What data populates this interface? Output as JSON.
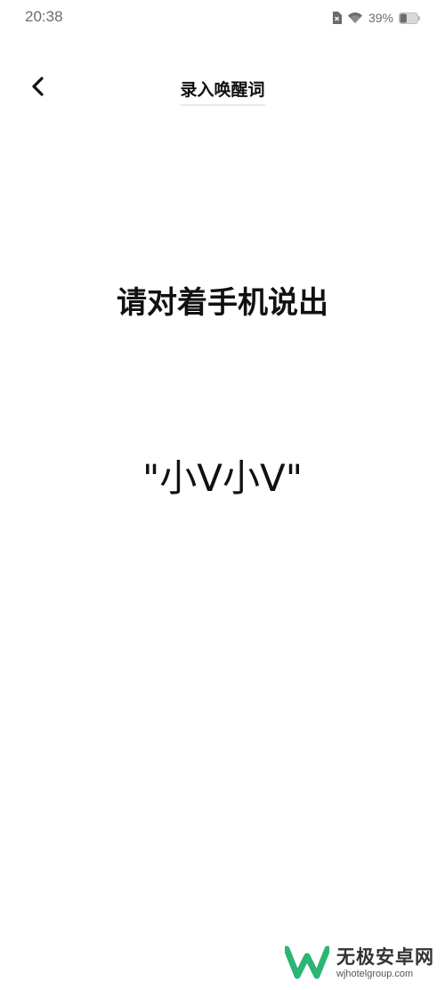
{
  "status_bar": {
    "time": "20:38",
    "battery_percent": "39%",
    "battery_level": 0.39,
    "icons": [
      "sim-off-icon",
      "wifi-icon",
      "battery-icon"
    ]
  },
  "header": {
    "title": "录入唤醒词",
    "back_icon": "back-chevron-icon"
  },
  "main": {
    "prompt": "请对着手机说出",
    "wake_word": "\"小V小V\""
  },
  "watermark": {
    "name": "无极安卓网",
    "url": "wjhotelgroup.com",
    "logo_icon": "watermark-logo-icon",
    "logo_color": "#2bb673"
  },
  "colors": {
    "background": "#ffffff",
    "text": "#111111",
    "status_text": "#6b6b6b"
  }
}
